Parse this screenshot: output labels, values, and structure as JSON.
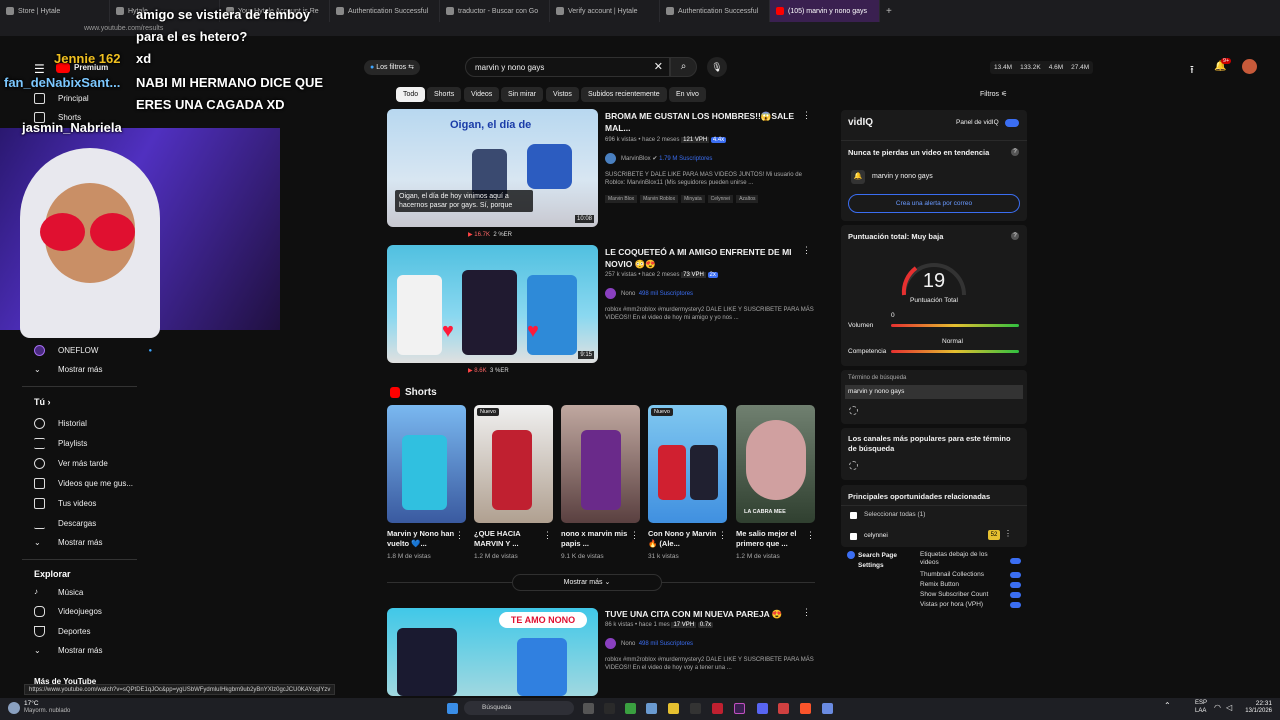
{
  "browser": {
    "tabs": [
      "Store | Hytale",
      "Hytale",
      "Your Hytale Account is Re",
      "Authentication Successful",
      "traductor - Buscar con Go",
      "Verify account | Hytale",
      "Authentication Successful",
      "(105) marvin y nono gays"
    ],
    "url": "www.youtube.com/results",
    "status_url": "https://www.youtube.com/watch?v=sQPtDE1qJOc&pp=ygUSbWFydmluIHkgbm9ub2yBnYXlz0gcJCU0KAYcqIYzv"
  },
  "chat": [
    {
      "user": "",
      "text": "amigo se vistiera de femboy"
    },
    {
      "user": "",
      "text": "para el es hetero?"
    },
    {
      "user": "Jennie 162",
      "text": "xd"
    },
    {
      "user": "fan_deNabixSant...",
      "text": "NABI MI HERMANO DICE QUE"
    },
    {
      "user": "",
      "text": "ERES UNA CAGADA XD"
    },
    {
      "user": "jasmin_Nabriela",
      "text": ""
    }
  ],
  "header": {
    "premium": "Premium",
    "filters_btn": "Los filtros",
    "search_value": "marvin y nono gays",
    "stats": [
      "13.4M",
      "133.2K",
      "4.6M",
      "27.4M"
    ],
    "notif_count": "9+"
  },
  "sidebar": {
    "top": [
      {
        "label": "Principal"
      },
      {
        "label": "Shorts"
      }
    ],
    "channel": "ONEFLOW",
    "more1": "Mostrar más",
    "you_heading": "Tú",
    "you_items": [
      "Historial",
      "Playlists",
      "Ver más tarde",
      "Videos que me gus...",
      "Tus videos",
      "Descargas",
      "Mostrar más"
    ],
    "explore_heading": "Explorar",
    "explore_items": [
      "Música",
      "Videojuegos",
      "Deportes",
      "Mostrar más"
    ],
    "more_youtube": "Más de YouTube"
  },
  "chips": [
    "Todo",
    "Shorts",
    "Videos",
    "Sin mirar",
    "Vistos",
    "Subidos recientemente",
    "En vivo"
  ],
  "filtros": "Filtros",
  "videos": [
    {
      "title": "BROMA ME GUSTAN LOS HOMBRES!!😱SALE MAL...",
      "meta": "696 k vistas • hace 2 meses",
      "vph": "121 VPH",
      "mult": "4.4x",
      "channel": "MarvinBlox",
      "subs": "1.79 M Suscriptores",
      "desc": "SUSCRIBETE Y DALE LIKE PARA MAS VIDEOS JUNTOS! Mi usuario de Roblox: MarvinBlox11 (Mis seguidores pueden unirse ...",
      "tags": [
        "Marvin Blox",
        "Marvin Roblox",
        "Minyata",
        "Celynnei",
        "Azaltos"
      ],
      "duration": "10:08",
      "caption": "Oigan, el día de hoy vinimos aquí a hacernos pasar por gays. Sí, porque",
      "overlay": "Oigan, el día de",
      "likes": "16.7K",
      "er": "2 %ER"
    },
    {
      "title": "LE COQUETEÓ A MI AMIGO ENFRENTE DE MI NOVIO 😳😍",
      "meta": "257 k vistas • hace 2 meses",
      "vph": "73 VPH",
      "mult": "2x",
      "channel": "Nono",
      "subs": "498 mil Suscriptores",
      "desc": "roblox #mm2roblox #murdermystery2 DALE LIKE Y SUSCRIBETE PARA MÁS VIDEOS!! En el video de hoy mi amigo y yo nos ...",
      "duration": "9:15",
      "likes": "8.6K",
      "er": "3 %ER"
    },
    {
      "title": "TUVE UNA CITA CON MI NUEVA PAREJA 😍",
      "meta": "86 k vistas • hace 1 mes",
      "vph": "17 VPH",
      "mult": "0.7x",
      "channel": "Nono",
      "subs": "498 mil Suscriptores",
      "desc": "roblox #mm2roblox #murdermystery2 DALE LIKE Y SUSCRIBETE PARA MÁS VIDEOS!! En el video de hoy voy a tener una ...",
      "overlay": "TE AMO NONO"
    }
  ],
  "shorts": {
    "heading": "Shorts",
    "badge": "Nuevo",
    "more": "Mostrar más",
    "items": [
      {
        "title": "Marvin y Nono han vuelto 💙...",
        "views": "1.8 M de vistas"
      },
      {
        "title": "¿QUE HACIA MARVIN Y ...",
        "views": "1.2 M de vistas"
      },
      {
        "title": "nono x marvin mis papis ...",
        "views": "9.1 K de vistas"
      },
      {
        "title": "Con Nono y Marvin🔥 (Ale...",
        "views": "31 k vistas"
      },
      {
        "title": "Me salio mejor el primero que ...",
        "views": "1.2 M de vistas"
      }
    ],
    "caption5": "LA CABRA MEE"
  },
  "vidiq": {
    "logo": "vidIQ",
    "panel_label": "Panel de vidIQ",
    "trending_title": "Nunca te pierdas un video en tendencia",
    "trending_term": "marvin y nono gays",
    "alert_btn": "Crea una alerta por correo",
    "score_title": "Puntuación total: Muy baja",
    "score": "19",
    "score_label": "Puntuación Total",
    "volume_label": "Volumen",
    "volume_value": "0",
    "competition_label": "Competencia",
    "competition_value": "Normal",
    "term_label": "Término de búsqueda",
    "term_value": "marvin y nono gays",
    "channels_title": "Los canales más populares para este término de búsqueda",
    "opps_title": "Principales oportunidades relacionadas",
    "select_all": "Seleccionar todas (1)",
    "opp_item": "celynnei",
    "opp_score": "52",
    "settings_title": "Search Page Settings",
    "settings": [
      "Etiquetas debajo de los videos",
      "Thumbnail Collections",
      "Remix Button",
      "Show Subscriber Count",
      "Vistas por hora (VPH)"
    ]
  },
  "taskbar": {
    "weather_temp": "17°C",
    "weather_desc": "Mayorm. nublado",
    "search": "Búsqueda",
    "lang": "ESP",
    "lang2": "LAA",
    "time": "22:31",
    "date": "13/1/2026"
  },
  "colors": {
    "accent": "#3ea6ff",
    "vidiq_blue": "#3b6ef2",
    "yt_red": "#ff0000"
  }
}
